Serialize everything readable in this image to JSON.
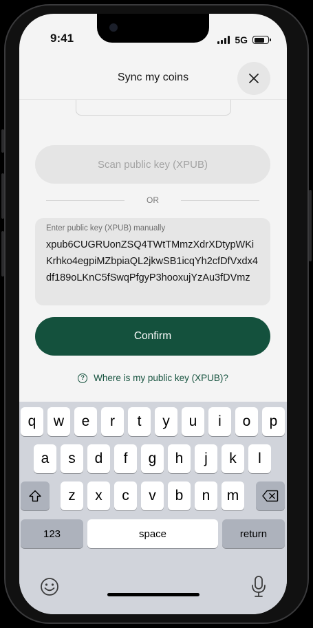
{
  "status": {
    "time": "9:41",
    "network": "5G"
  },
  "header": {
    "title": "Sync my coins"
  },
  "scan_button": "Scan public key (XPUB)",
  "divider": "OR",
  "input": {
    "label": "Enter public key (XPUB) manually",
    "value": "xpub6CUGRUonZSQ4TWtTMmzXdrXDtypWKiKrhko4egpiMZbpiaQL2jkwSB1icqYh2cfDfVxdx4df189oLKnC5fSwqPfgyP3hooxujYzAu3fDVmz"
  },
  "confirm_button": "Confirm",
  "help_link": "Where is my public key (XPUB)?",
  "keyboard": {
    "row1": [
      "q",
      "w",
      "e",
      "r",
      "t",
      "y",
      "u",
      "i",
      "o",
      "p"
    ],
    "row2": [
      "a",
      "s",
      "d",
      "f",
      "g",
      "h",
      "j",
      "k",
      "l"
    ],
    "row3": [
      "z",
      "x",
      "c",
      "v",
      "b",
      "n",
      "m"
    ],
    "numbers_key": "123",
    "space_key": "space",
    "return_key": "return"
  },
  "colors": {
    "brand": "#14513d",
    "screen_bg": "#f4f4f4",
    "keyboard_bg": "#d1d4db"
  },
  "icons": [
    "close-icon",
    "help-icon",
    "shift-icon",
    "backspace-icon",
    "emoji-icon",
    "microphone-icon"
  ]
}
